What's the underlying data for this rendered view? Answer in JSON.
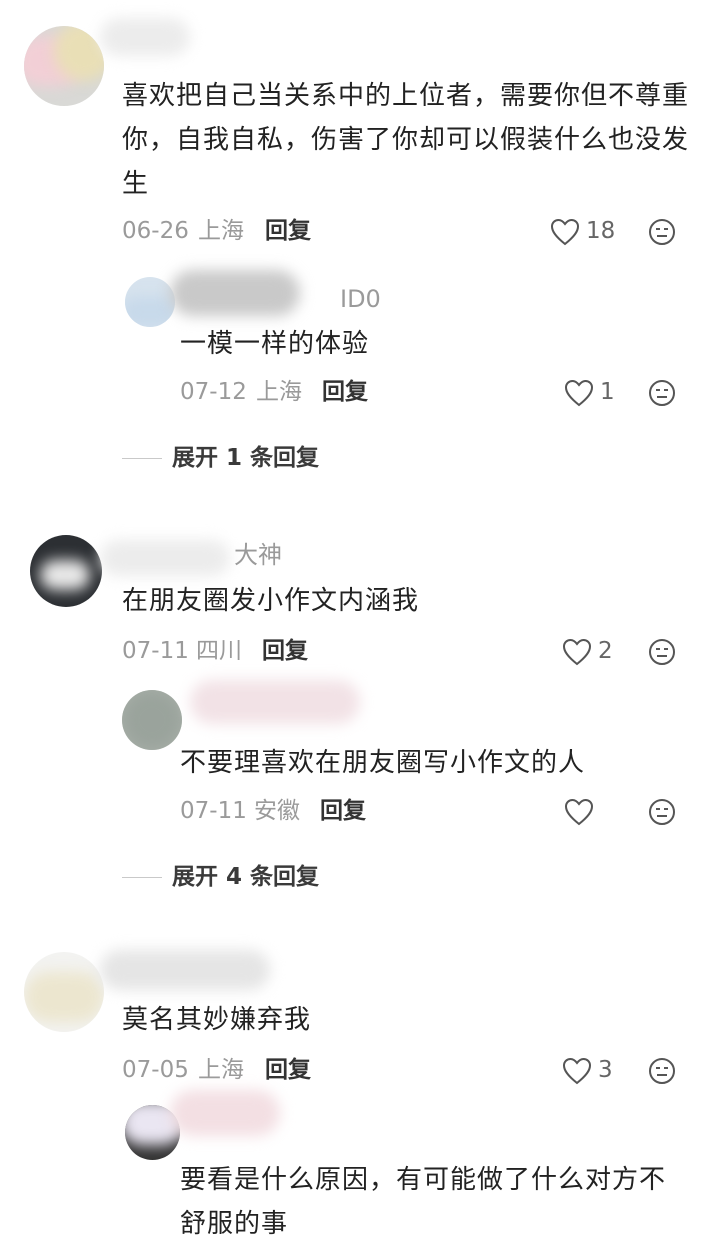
{
  "comments": [
    {
      "name": "",
      "text": "喜欢把自己当关系中的上位者，需要你但不尊重你，自我自私，伤害了你却可以假装什么也没发生",
      "date": "06-26",
      "location": "上海",
      "reply_label": "回复",
      "likes": "18",
      "replies": [
        {
          "name": "ID0",
          "text": "一模一样的体验",
          "date": "07-12",
          "location": "上海",
          "reply_label": "回复",
          "likes": "1"
        }
      ],
      "expand_label": "展开 1 条回复"
    },
    {
      "name": "大神",
      "text": "在朋友圈发小作文内涵我",
      "date": "07-11",
      "location": "四川",
      "reply_label": "回复",
      "likes": "2",
      "replies": [
        {
          "name": "",
          "text": "不要理喜欢在朋友圈写小作文的人",
          "date": "07-11",
          "location": "安徽",
          "reply_label": "回复",
          "likes": ""
        }
      ],
      "expand_label": "展开 4 条回复"
    },
    {
      "name": "",
      "text": "莫名其妙嫌弃我",
      "date": "07-05",
      "location": "上海",
      "reply_label": "回复",
      "likes": "3",
      "replies": [
        {
          "name": "",
          "text": "要看是什么原因，有可能做了什么对方不舒服的事"
        }
      ]
    }
  ],
  "icons": {
    "like": "heart-outline-icon",
    "more": "neutral-face-icon"
  },
  "colors": {
    "meta": "#9a9a9a",
    "text": "#222222",
    "icon": "#555555"
  }
}
